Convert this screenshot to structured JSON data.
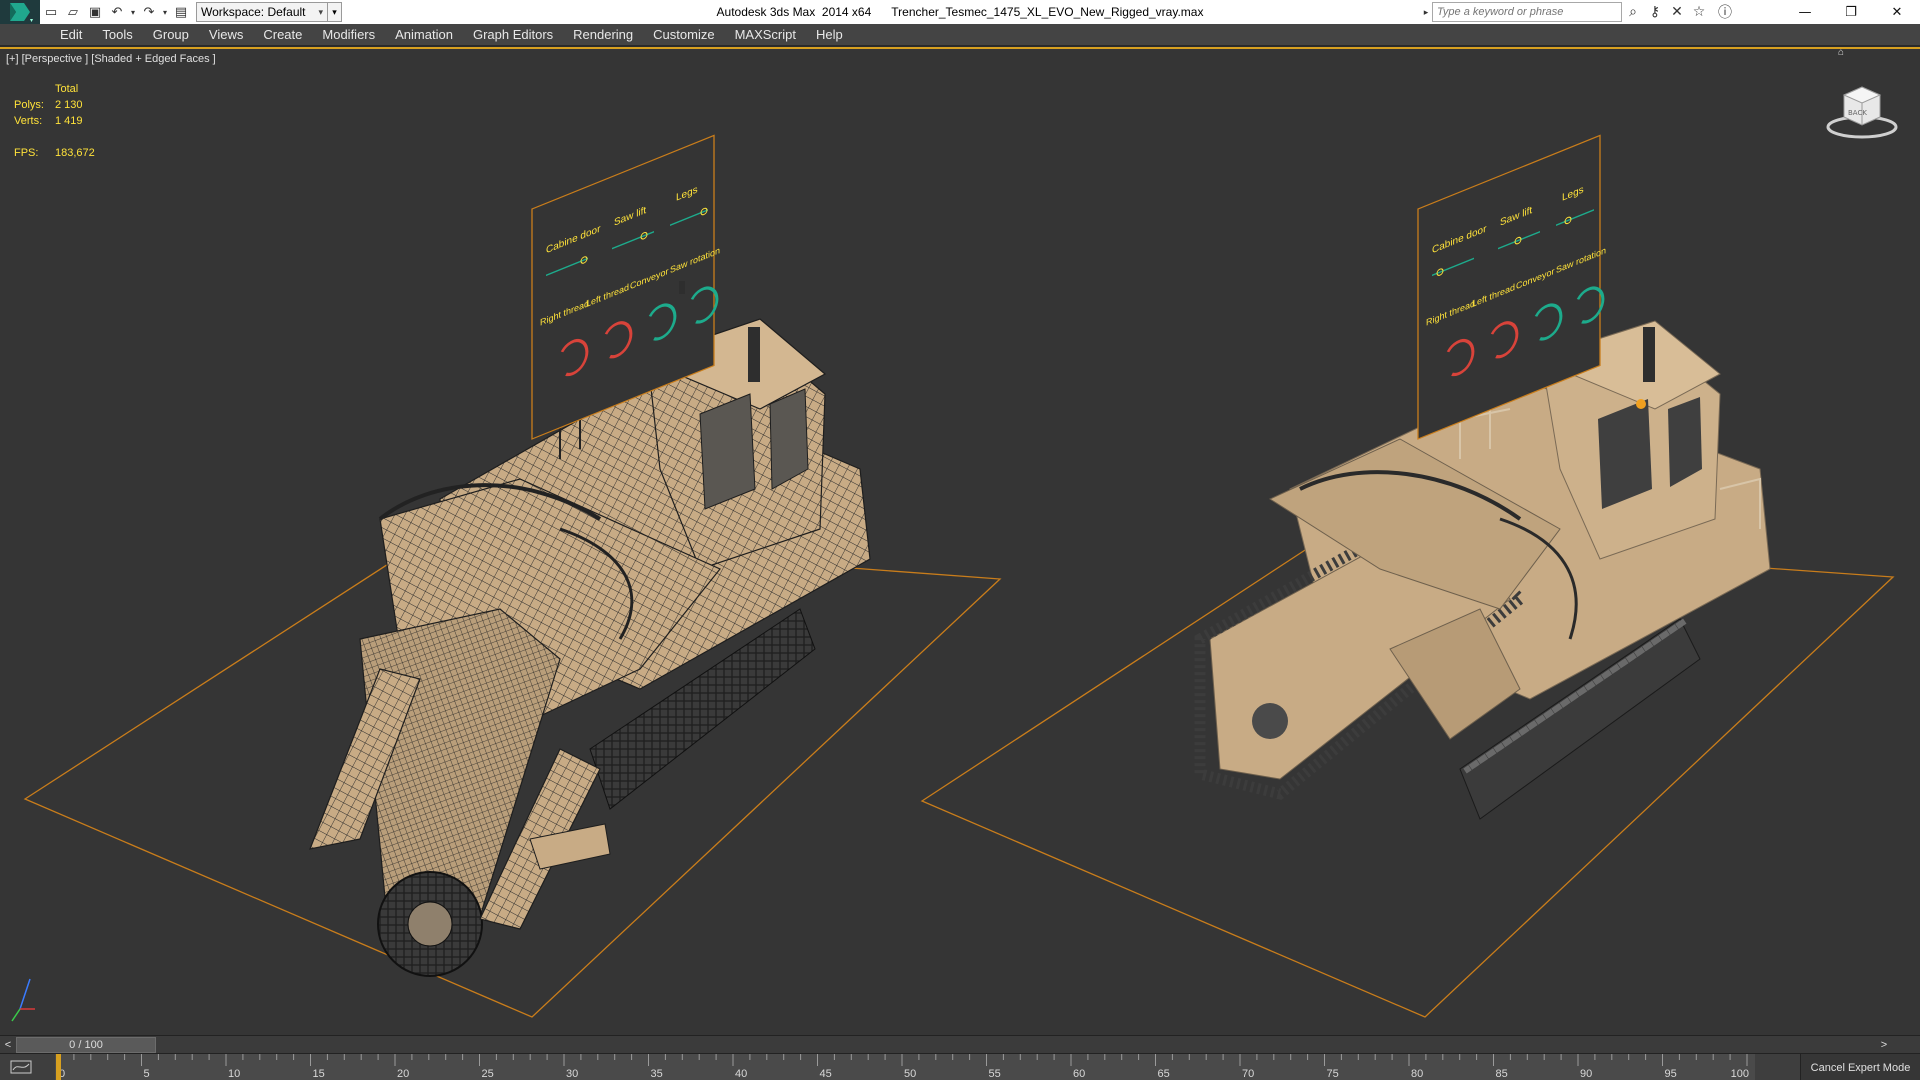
{
  "titlebar": {
    "app": "Autodesk 3ds Max  2014 x64",
    "file": "Trencher_Tesmec_1475_XL_EVO_New_Rigged_vray.max",
    "workspace": "Workspace: Default",
    "search_placeholder": "Type a keyword or phrase",
    "quick_access": [
      "new-file-icon",
      "open-folder-icon",
      "save-icon",
      "undo-icon",
      "redo-icon",
      "project-folder-icon"
    ],
    "window_controls": [
      "minimize-icon",
      "restore-icon",
      "close-icon"
    ]
  },
  "menu": [
    {
      "label": "Edit"
    },
    {
      "label": "Tools"
    },
    {
      "label": "Group"
    },
    {
      "label": "Views"
    },
    {
      "label": "Create"
    },
    {
      "label": "Modifiers"
    },
    {
      "label": "Animation"
    },
    {
      "label": "Graph Editors"
    },
    {
      "label": "Rendering"
    },
    {
      "label": "Customize"
    },
    {
      "label": "MAXScript"
    },
    {
      "label": "Help"
    }
  ],
  "viewport": {
    "label": "[+] [Perspective ] [Shaded + Edged Faces ]",
    "stats": {
      "header": "Total",
      "polys_label": "Polys:",
      "polys": "2 130",
      "verts_label": "Verts:",
      "verts": "1 419",
      "fps_label": "FPS:",
      "fps": "183,672"
    },
    "rig_panel_labels": [
      "Cabine door",
      "Saw lift",
      "Legs",
      "Right thread",
      "Left thread",
      "Conveyor",
      "Saw rotation"
    ],
    "viewcube_label": "BACK"
  },
  "timeline": {
    "frame_display": "0 / 100",
    "prev_label": "<",
    "next_label": ">",
    "current_frame": 0,
    "total_frames": 100,
    "ticks": [
      "0",
      "5",
      "10",
      "15",
      "20",
      "25",
      "30",
      "35",
      "40",
      "45",
      "50",
      "55",
      "60",
      "65",
      "70",
      "75",
      "80",
      "85",
      "90",
      "95",
      "100"
    ]
  },
  "status": {
    "expert_button": "Cancel Expert Mode"
  },
  "colors": {
    "accent": "#d7a020",
    "stats_text": "#ffe23a",
    "grid_outline": "#c97d1b",
    "model_tan": "#c8ab85",
    "panel_red": "#d8433a",
    "panel_teal": "#1dab8c"
  }
}
